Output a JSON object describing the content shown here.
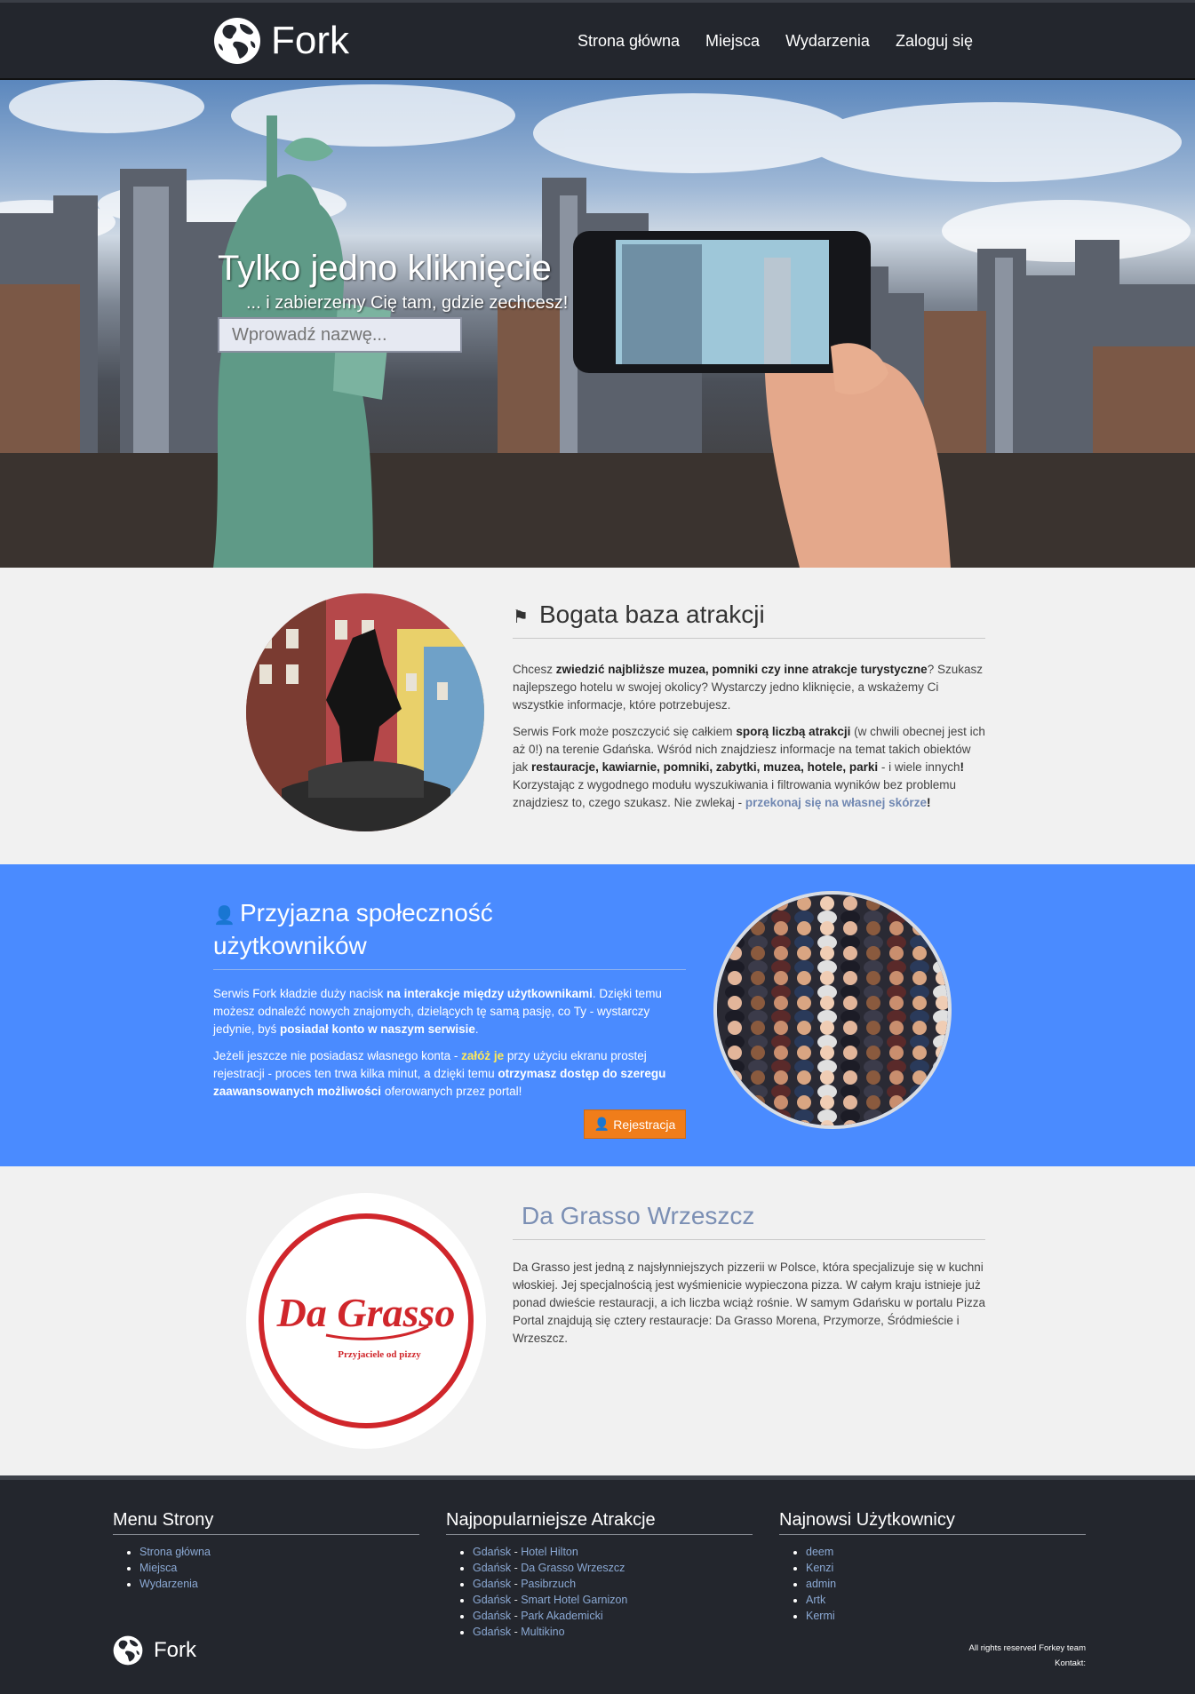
{
  "navbar": {
    "brand": "Fork",
    "items": [
      "Strona główna",
      "Miejsca",
      "Wydarzenia",
      "Zaloguj się"
    ]
  },
  "hero": {
    "title": "Tylko jedno kliknięcie",
    "subtitle": "... i zabierzemy Cię tam, gdzie zechcesz!",
    "search_placeholder": "Wprowadź nazwę..."
  },
  "attractions": {
    "title": "Bogata baza atrakcji",
    "icon": "flag-icon",
    "p1": {
      "a": "Chcesz ",
      "b": "zwiedzić najbliższe muzea, pomniki czy inne atrakcje turystyczne",
      "c": "? Szukasz najlepszego hotelu w swojej okolicy? Wystarczy jedno kliknięcie, a wskażemy Ci wszystkie informacje, które potrzebujesz."
    },
    "p2": {
      "a": "Serwis Fork może poszczycić się całkiem ",
      "b": "sporą liczbą atrakcji",
      "c": " (w chwili obecnej jest ich aż 0!) na terenie Gdańska. Wśród nich znajdziesz informacje na temat takich obiektów jak ",
      "d": "restauracje, kawiarnie, pomniki, zabytki, muzea, hotele, parki",
      "e": " - i wiele innych",
      "f": "!",
      "g": " Korzystając z wygodnego modułu wyszukiwania i filtrowania wyników bez problemu znajdziesz to, czego szukasz. Nie zwlekaj - ",
      "link": "przekonaj się na własnej skórze",
      "h": "!"
    }
  },
  "community": {
    "title_line1": "Przyjazna społeczność",
    "title_line2": "użytkowników",
    "icon": "user-icon",
    "p1": {
      "a": "Serwis Fork kładzie duży nacisk ",
      "b": "na interakcje między użytkownikami",
      "c": ". Dzięki temu możesz odnaleźć nowych znajomych, dzielących tę samą pasję, co Ty - wystarczy jedynie, byś ",
      "d": "posiadał konto w naszym serwisie",
      "e": "."
    },
    "p2": {
      "a": "Jeżeli jeszcze nie posiadasz własnego konta - ",
      "link": "załóż je",
      "b": " przy użyciu ekranu prostej rejestracji - proces ten trwa kilka minut, a dzięki temu ",
      "c": "otrzymasz dostęp do szeregu zaawansowanych możliwości",
      "d": " oferowanych przez portal!"
    },
    "button": "Rejestracja"
  },
  "featured": {
    "title": "Da Grasso Wrzeszcz",
    "logo_text": "Da Grasso",
    "logo_tagline": "Przyjaciele od pizzy",
    "description": "Da Grasso jest jedną z najsłynniejszych pizzerii w Polsce, która specjalizuje się w kuchni włoskiej. Jej specjalnością jest wyśmienicie wypieczona pizza. W całym kraju istnieje już ponad dwieście restauracji, a ich liczba wciąż rośnie. W samym Gdańsku w portalu Pizza Portal znajdują się cztery restauracje: Da Grasso Morena, Przymorze, Śródmieście i Wrzeszcz."
  },
  "footer": {
    "menu": {
      "title": "Menu Strony",
      "items": [
        "Strona główna",
        "Miejsca",
        "Wydarzenia"
      ]
    },
    "popular": {
      "title": "Najpopularniejsze Atrakcje",
      "sep": " - ",
      "items": [
        {
          "city": "Gdańsk",
          "name": "Hotel Hilton"
        },
        {
          "city": "Gdańsk",
          "name": "Da Grasso Wrzeszcz"
        },
        {
          "city": "Gdańsk",
          "name": "Pasibrzuch"
        },
        {
          "city": "Gdańsk",
          "name": "Smart Hotel Garnizon"
        },
        {
          "city": "Gdańsk",
          "name": "Park Akademicki"
        },
        {
          "city": "Gdańsk",
          "name": "Multikino"
        }
      ]
    },
    "users": {
      "title": "Najnowsi Użytkownicy",
      "items": [
        "deem",
        "Kenzi",
        "admin",
        "Artk",
        "Kermi"
      ]
    },
    "brand": "Fork",
    "rights": "All rights reserved Forkey team",
    "contact": "Kontakt:"
  },
  "colors": {
    "navbar_bg": "#23262d",
    "community_bg": "#4a8bff",
    "register_button": "#f07d1a",
    "link_blue": "#7188b2"
  }
}
